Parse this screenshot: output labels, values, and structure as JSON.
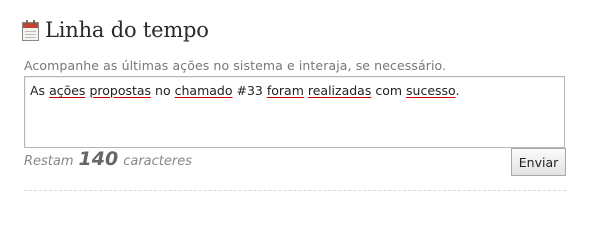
{
  "header": {
    "title": "Linha do tempo",
    "icon": "calendar-icon"
  },
  "description": "Acompanhe as últimas ações no sistema e interaja, se necessário.",
  "message": {
    "words": [
      {
        "text": "As",
        "misspelled": false
      },
      {
        "text": "ações",
        "misspelled": true
      },
      {
        "text": "propostas",
        "misspelled": true
      },
      {
        "text": "no",
        "misspelled": false
      },
      {
        "text": "chamado",
        "misspelled": true
      },
      {
        "text": "#33",
        "misspelled": false
      },
      {
        "text": "foram",
        "misspelled": true
      },
      {
        "text": "realizadas",
        "misspelled": true
      },
      {
        "text": "com",
        "misspelled": false
      },
      {
        "text": "sucesso",
        "misspelled": true
      },
      {
        "text": ".",
        "misspelled": false
      }
    ]
  },
  "counter": {
    "prefix": "Restam",
    "remaining": "140",
    "suffix": "caracteres"
  },
  "send_button": {
    "label": "Enviar"
  },
  "colors": {
    "spell_underline": "#cc0000",
    "title": "#2a2a2a",
    "muted": "#777777"
  }
}
